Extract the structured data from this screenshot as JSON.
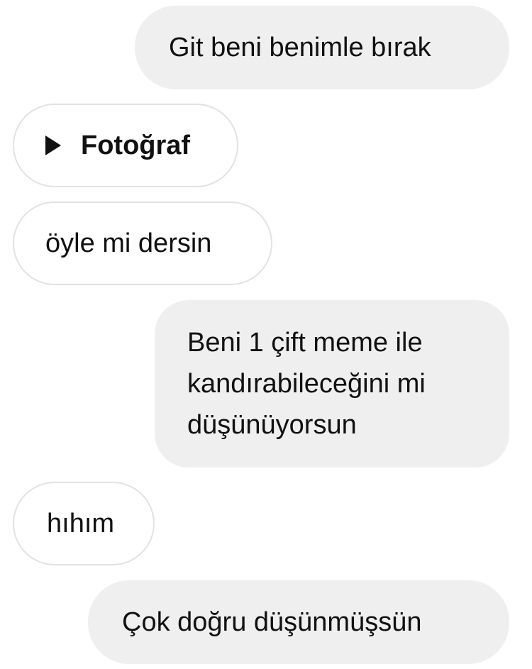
{
  "messages": [
    {
      "direction": "outgoing",
      "text": "Git beni benimle bırak"
    },
    {
      "direction": "incoming",
      "type": "photo",
      "icon": "play-icon",
      "text": "Fotoğraf"
    },
    {
      "direction": "incoming",
      "text": "öyle mi dersin"
    },
    {
      "direction": "outgoing",
      "lines": [
        "Beni 1 çift meme ile",
        "kandırabileceğini mi",
        "düşünüyorsun"
      ]
    },
    {
      "direction": "incoming",
      "text": "hıhım"
    },
    {
      "direction": "outgoing",
      "text": "Çok doğru düşünmüşsün"
    }
  ],
  "colors": {
    "outgoing_bubble": "#efefef",
    "incoming_border": "#e2e2e2",
    "text": "#111111"
  }
}
